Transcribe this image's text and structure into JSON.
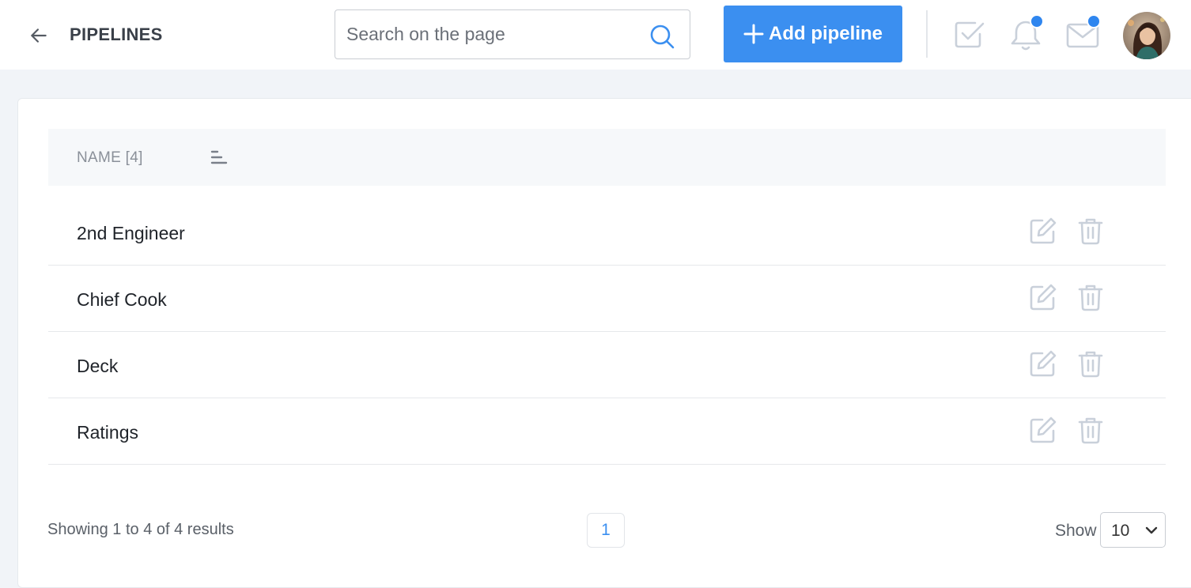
{
  "header": {
    "title": "PIPELINES",
    "search_placeholder": "Search on the page",
    "add_label": "Add pipeline"
  },
  "icons": {
    "back": "arrow-left-icon",
    "search": "search-icon",
    "tasks": "checkbox-icon",
    "notifications": "bell-icon",
    "messages": "mail-icon",
    "sort": "sort-icon",
    "edit": "edit-icon",
    "delete": "trash-icon"
  },
  "colors": {
    "primary": "#3b8ff0",
    "badge": "#2f86ef",
    "icon_muted": "#c9d0da",
    "background": "#f1f4f8"
  },
  "table": {
    "column_name": "NAME [4]",
    "rows": [
      {
        "name": "2nd Engineer"
      },
      {
        "name": "Chief Cook"
      },
      {
        "name": "Deck"
      },
      {
        "name": "Ratings"
      }
    ]
  },
  "footer": {
    "showing": "Showing 1 to 4 of 4 results",
    "current_page": "1",
    "show_label": "Show",
    "page_size": "10"
  }
}
